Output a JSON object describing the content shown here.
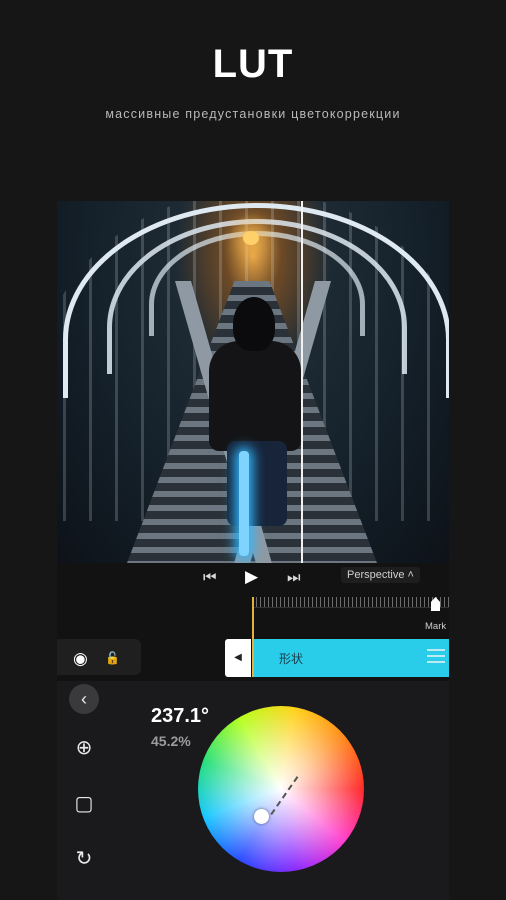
{
  "header": {
    "title": "LUT",
    "subtitle": "массивные предустановки цветокоррекции"
  },
  "transport": {
    "prev_icon": "⏮",
    "play_icon": "▶",
    "next_icon": "⏭",
    "perspective_label": "Perspective"
  },
  "timeline": {
    "mark_label": "Mark",
    "clip_label": "形状"
  },
  "color_panel": {
    "hue_value": "237.1°",
    "saturation_value": "45.2%"
  },
  "colors": {
    "accent_clip": "#29cdea",
    "playhead": "#e7b03a",
    "background": "#161616"
  },
  "icons": [
    "eye-icon",
    "unlock-icon",
    "back-icon",
    "add-keyframe-icon",
    "crop-icon",
    "rotate-icon",
    "menu-icon"
  ]
}
